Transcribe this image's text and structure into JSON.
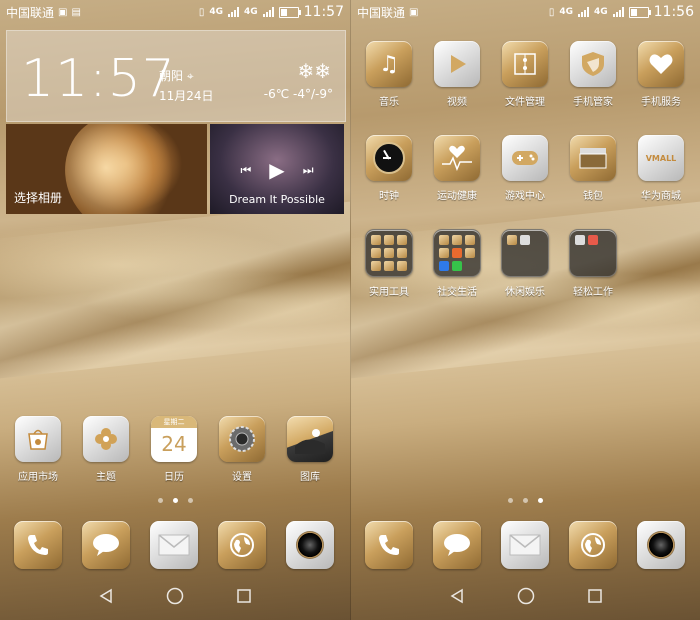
{
  "left": {
    "status": {
      "carrier": "中国联通",
      "network": "4G",
      "network2": "4G",
      "time": "11:57",
      "battery_level": 0.35
    },
    "clock_widget": {
      "time": "11:57",
      "city": "朝阳",
      "date": "11月24日",
      "temperature": "-6℃",
      "range": "-4°/-9°",
      "weather_icon": "snow-icon"
    },
    "album_widget": {
      "label": "选择相册"
    },
    "music_widget": {
      "title": "Dream It Possible"
    },
    "apps": [
      {
        "label": "应用市场",
        "icon": "app-store-icon"
      },
      {
        "label": "主题",
        "icon": "theme-icon"
      },
      {
        "label": "日历",
        "icon": "calendar-icon",
        "cal_header": "星期二",
        "cal_day": "24"
      },
      {
        "label": "设置",
        "icon": "settings-icon"
      },
      {
        "label": "图库",
        "icon": "gallery-icon"
      }
    ],
    "pages": {
      "count": 3,
      "active": 2
    },
    "dock": [
      {
        "icon": "phone-icon"
      },
      {
        "icon": "messages-icon"
      },
      {
        "icon": "email-icon"
      },
      {
        "icon": "browser-icon"
      },
      {
        "icon": "camera-icon"
      }
    ]
  },
  "right": {
    "status": {
      "carrier": "中国联通",
      "network": "4G",
      "network2": "4G",
      "time": "11:56",
      "battery_level": 0.35
    },
    "apps": [
      {
        "label": "音乐",
        "icon": "music-icon"
      },
      {
        "label": "视频",
        "icon": "video-icon"
      },
      {
        "label": "文件管理",
        "icon": "file-manager-icon"
      },
      {
        "label": "手机管家",
        "icon": "phone-manager-icon"
      },
      {
        "label": "手机服务",
        "icon": "phone-service-icon"
      },
      {
        "label": "时钟",
        "icon": "clock-icon"
      },
      {
        "label": "运动健康",
        "icon": "health-icon"
      },
      {
        "label": "游戏中心",
        "icon": "game-center-icon"
      },
      {
        "label": "钱包",
        "icon": "wallet-icon"
      },
      {
        "label": "华为商城",
        "icon": "vmall-icon",
        "badge_text": "VMALL"
      },
      {
        "label": "实用工具",
        "icon": "tools-folder-icon"
      },
      {
        "label": "社交生活",
        "icon": "social-folder-icon"
      },
      {
        "label": "休闲娱乐",
        "icon": "leisure-folder-icon"
      },
      {
        "label": "轻松工作",
        "icon": "work-folder-icon"
      }
    ],
    "pages": {
      "count": 3,
      "active": 3
    },
    "dock": [
      {
        "icon": "phone-icon"
      },
      {
        "icon": "messages-icon"
      },
      {
        "icon": "email-icon"
      },
      {
        "icon": "browser-icon"
      },
      {
        "icon": "camera-icon"
      }
    ]
  },
  "nav": {
    "back_icon": "back-icon",
    "home_icon": "home-icon",
    "recent_icon": "recent-apps-icon"
  }
}
